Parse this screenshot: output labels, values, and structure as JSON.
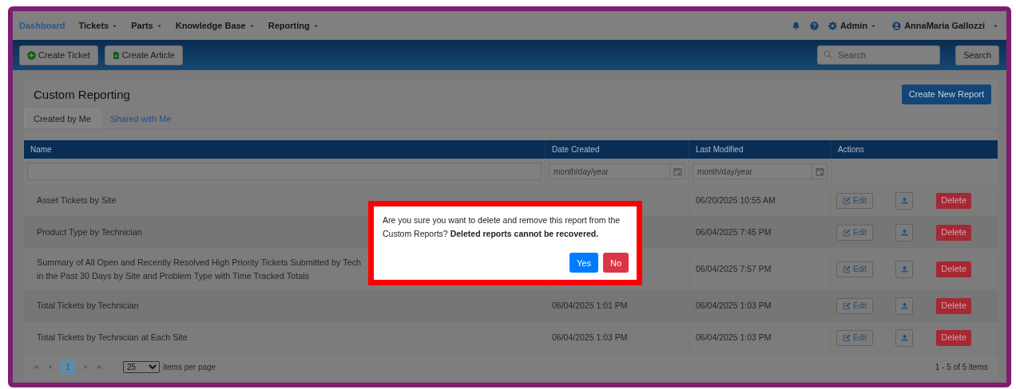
{
  "nav": {
    "items": [
      {
        "label": "Dashboard",
        "selected": true,
        "dropdown": false
      },
      {
        "label": "Tickets",
        "selected": false,
        "dropdown": true
      },
      {
        "label": "Parts",
        "selected": false,
        "dropdown": true
      },
      {
        "label": "Knowledge Base",
        "selected": false,
        "dropdown": true
      },
      {
        "label": "Reporting",
        "selected": false,
        "dropdown": true
      }
    ],
    "admin": "Admin",
    "user": "AnnaMaria Gallozzi"
  },
  "toolbar": {
    "buttons": [
      {
        "label": "Create Ticket",
        "kind": "ticket"
      },
      {
        "label": "Create Article",
        "kind": "article"
      }
    ],
    "search": {
      "placeholder": "Search"
    },
    "search_button": "Search"
  },
  "page": {
    "title": "Custom Reporting",
    "create_button": "Create New Report",
    "tabs": [
      {
        "label": "Created by Me",
        "selected": true
      },
      {
        "label": "Shared with Me",
        "selected": false
      }
    ]
  },
  "table": {
    "columns": [
      "Name",
      "Date Created",
      "Last Modified",
      "Actions"
    ],
    "filters": [
      {
        "kind": "text"
      },
      {
        "kind": "date",
        "placeholder": "month/day/year"
      },
      {
        "kind": "date",
        "placeholder": "month/day/year"
      },
      {
        "kind": "none"
      }
    ],
    "rows": [
      {
        "name": "Asset Tickets by Site",
        "last_modified": "06/20/2025 10:55 AM",
        "edit": "Edit",
        "delete": "Delete"
      },
      {
        "name": "Product Type by Technician",
        "last_modified": "06/04/2025 7:45 PM",
        "edit": "Edit",
        "delete": "Delete"
      },
      {
        "name": "Summary of All Open and Recently Resolved High Priority Tickets Submitted by Tech\nin the Past 30 Days by Site and Problem Type with Time Tracked Totals",
        "last_modified": "06/04/2025 7:57 PM",
        "edit": "Edit",
        "delete": "Delete"
      },
      {
        "name": "Total Tickets by Technician",
        "date_created": "06/04/2025 1:01 PM",
        "last_modified": "06/04/2025 1:03 PM",
        "edit": "Edit",
        "delete": "Delete"
      },
      {
        "name": "Total Tickets by Technician at Each Site",
        "date_created": "06/04/2025 1:03 PM",
        "last_modified": "06/04/2025 1:03 PM",
        "edit": "Edit",
        "delete": "Delete"
      }
    ]
  },
  "pager": {
    "pages": [
      {
        "label": "1",
        "selected": true
      }
    ],
    "page_size": "25",
    "page_size_label": "items per page",
    "summary": "1 - 5 of 5 items"
  },
  "modal": {
    "message": "Are you sure you want to delete and remove this report from the Custom Reports? **Deleted reports cannot be recovered.**",
    "buttons": [
      {
        "label": "Yes",
        "kind": "primary"
      },
      {
        "label": "No",
        "kind": "danger"
      }
    ]
  }
}
